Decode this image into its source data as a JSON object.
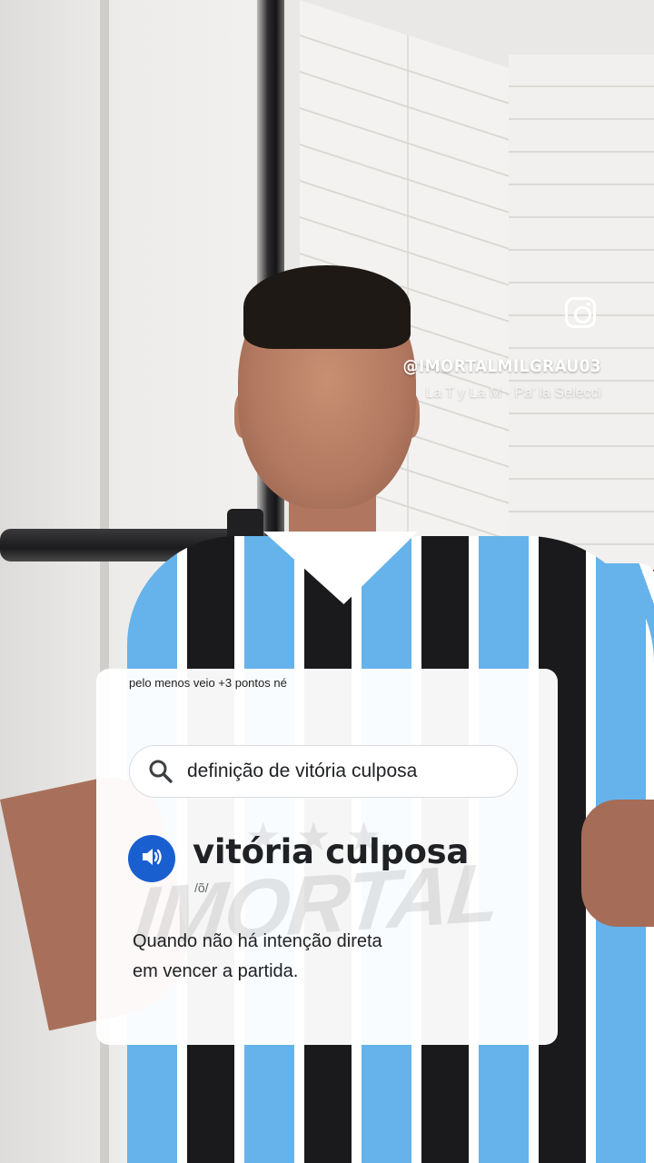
{
  "overlay": {
    "instagram_handle": "@IMORTALMILGRAU03",
    "music_label": "La T y La M · Pa' la Selecci"
  },
  "card": {
    "caption": "pelo menos veio +3 pontos né",
    "search_query": "definição de vitória culposa",
    "term": "vitória culposa",
    "phonetic": "/õ/",
    "definition_line1": "Quando não há intenção direta",
    "definition_line2": "em vencer a partida.",
    "watermark_text": "IMORTAL"
  },
  "colors": {
    "speaker_button": "#1a5fd0",
    "jersey_blue": "#65b3ea",
    "jersey_black": "#1a1a1d"
  },
  "icons": {
    "instagram": "instagram-icon",
    "search": "search-icon",
    "speaker": "speaker-icon"
  }
}
